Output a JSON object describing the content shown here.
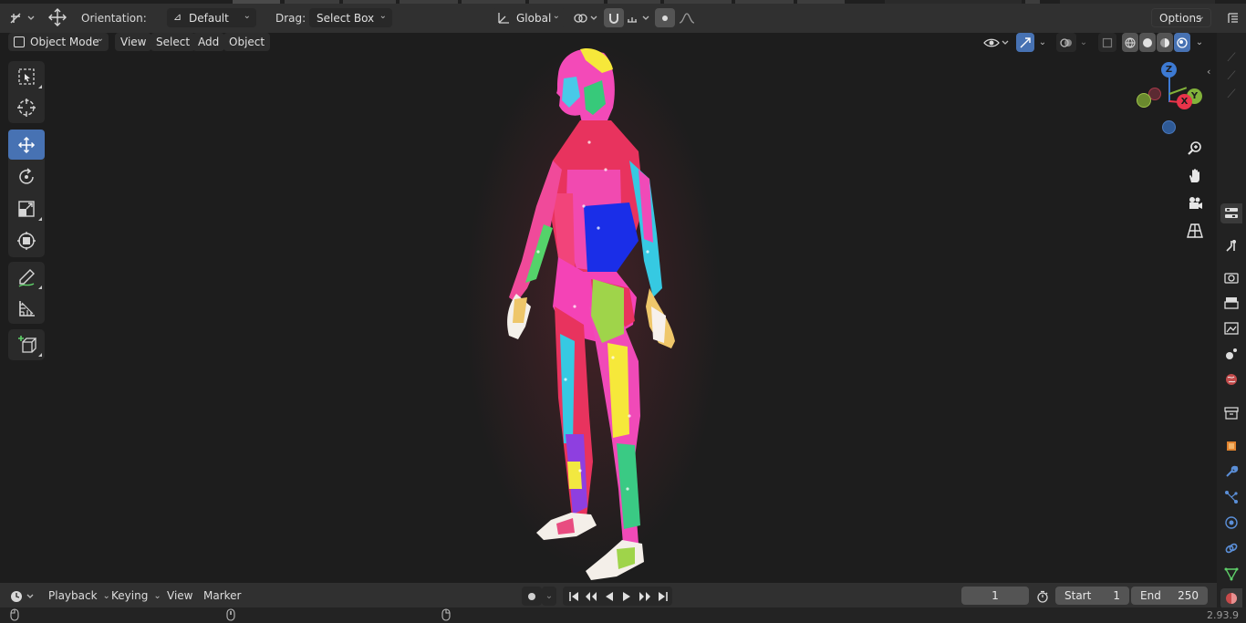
{
  "header": {
    "orientation_label": "Orientation:",
    "orientation_value": "Default",
    "drag_label": "Drag:",
    "drag_value": "Select Box",
    "transform_space": "Global",
    "options_label": "Options"
  },
  "viewport_header": {
    "mode": "Object Mode",
    "menus": [
      "View",
      "Select",
      "Add",
      "Object"
    ]
  },
  "gizmo": {
    "axis_z": "Z",
    "axis_y": "Y",
    "axis_x": "X",
    "color_x": "#e8344a",
    "color_y": "#82b23a",
    "color_z": "#3d7ad3"
  },
  "timeline": {
    "menus": [
      "Playback",
      "Keying",
      "View",
      "Marker"
    ],
    "current_frame": "1",
    "start_label": "Start",
    "start_value": "1",
    "end_label": "End",
    "end_value": "250"
  },
  "status": {
    "version": "2.93.9"
  },
  "colors": {
    "accent": "#4772b3",
    "viewport_bg": "#1d1d1d",
    "header_bg": "#303030"
  }
}
